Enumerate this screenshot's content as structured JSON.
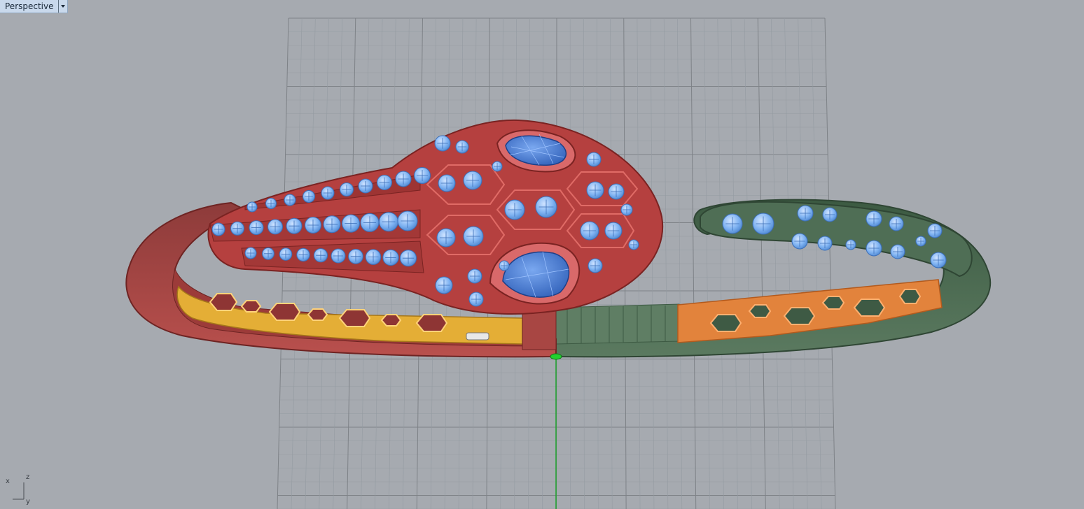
{
  "viewport": {
    "title": "Perspective",
    "dropdown_icon": "chevron-down-icon"
  },
  "axis_gizmo": {
    "x_label": "x",
    "y_label": "y",
    "z_label": "z"
  },
  "colors": {
    "background": "#a6aab0",
    "grid_line": "#8f9398",
    "grid_major": "#7e8287",
    "red_part": "#b54746",
    "green_part": "#4c6a52",
    "gem_blue": "#7fb3f2",
    "yellow_part": "#e4ae36",
    "orange_part": "#e2833c",
    "axis_green": "#1fa32d"
  }
}
